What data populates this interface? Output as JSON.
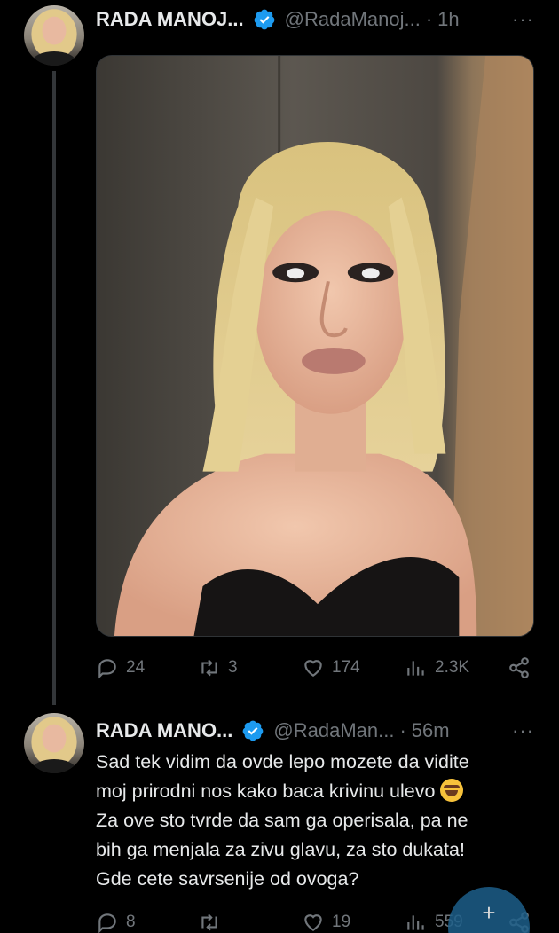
{
  "tweets": [
    {
      "name": "RADA MANOJ...",
      "handle": "@RadaManoj...",
      "time": "1h",
      "photo_description_icon": "selfie-photo",
      "stats": {
        "replies": "24",
        "retweets": "3",
        "likes": "174",
        "views": "2.3K"
      }
    },
    {
      "name": "RADA MANO...",
      "handle": "@RadaMan...",
      "time": "56m",
      "text_lines": [
        "Sad tek vidim da ovde lepo mozete da vidite",
        "moj prirodni nos kako baca krivinu ulevo",
        "Za ove sto tvrde da sam ga operisala, pa ne",
        "bih ga menjala za zivu glavu, za sto dukata!",
        "Gde cete savrsenije od ovoga?"
      ],
      "emoji_icon": "rolling-laughing-emoji",
      "stats": {
        "replies": "8",
        "retweets": "",
        "likes": "19",
        "views": "559"
      }
    }
  ],
  "ui": {
    "separator": "·",
    "more": "···",
    "compose_icon": "compose-plus-icon",
    "compose_glyph": "+",
    "accent": "#1d9bf0",
    "muted": "#71767b"
  }
}
